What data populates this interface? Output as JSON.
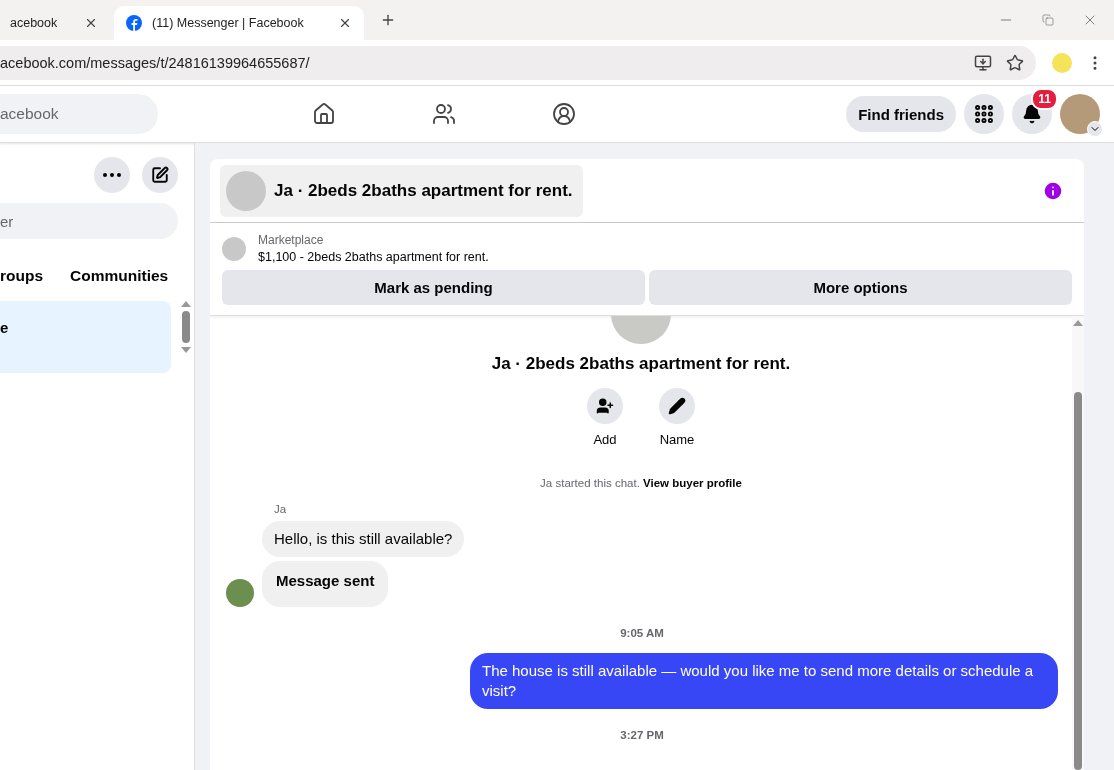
{
  "browser": {
    "tabs": [
      {
        "title": "acebook",
        "selected": false
      },
      {
        "title": "(11) Messenger | Facebook",
        "selected": true
      }
    ],
    "url": "acebook.com/messages/t/24816139964655687/"
  },
  "topbar": {
    "search_placeholder": "acebook",
    "find_friends": "Find friends",
    "notification_count": "11"
  },
  "sidebar": {
    "search_placeholder": "er",
    "tabs": [
      {
        "label": "roups",
        "selected": false
      },
      {
        "label": "Communities",
        "selected": false
      }
    ],
    "chats": [
      {
        "name": "e",
        "selected": true
      }
    ]
  },
  "chat": {
    "title": "Ja · 2beds 2baths apartment for rent.",
    "listing": {
      "source": "Marketplace",
      "summary": "$1,100 - 2beds 2baths apartment for rent."
    },
    "actions": [
      "Mark as pending",
      "More options"
    ],
    "intro_title": "Ja · 2beds 2baths apartment for rent.",
    "intro_actions": [
      {
        "kind": "add",
        "label": "Add"
      },
      {
        "kind": "name",
        "label": "Name"
      }
    ],
    "started_note": "Ja started this chat.",
    "started_link": "View buyer profile",
    "messages": [
      {
        "kind": "sender",
        "text": "Ja"
      },
      {
        "kind": "incoming",
        "text": "Hello, is this still available?"
      },
      {
        "kind": "notice",
        "text": "Message sent"
      },
      {
        "kind": "time",
        "text": "9:05 AM"
      },
      {
        "kind": "outgoing",
        "text": "The house is still available — would you like me to send more details or schedule a visit?"
      },
      {
        "kind": "time",
        "text": "3:27 PM"
      }
    ]
  }
}
